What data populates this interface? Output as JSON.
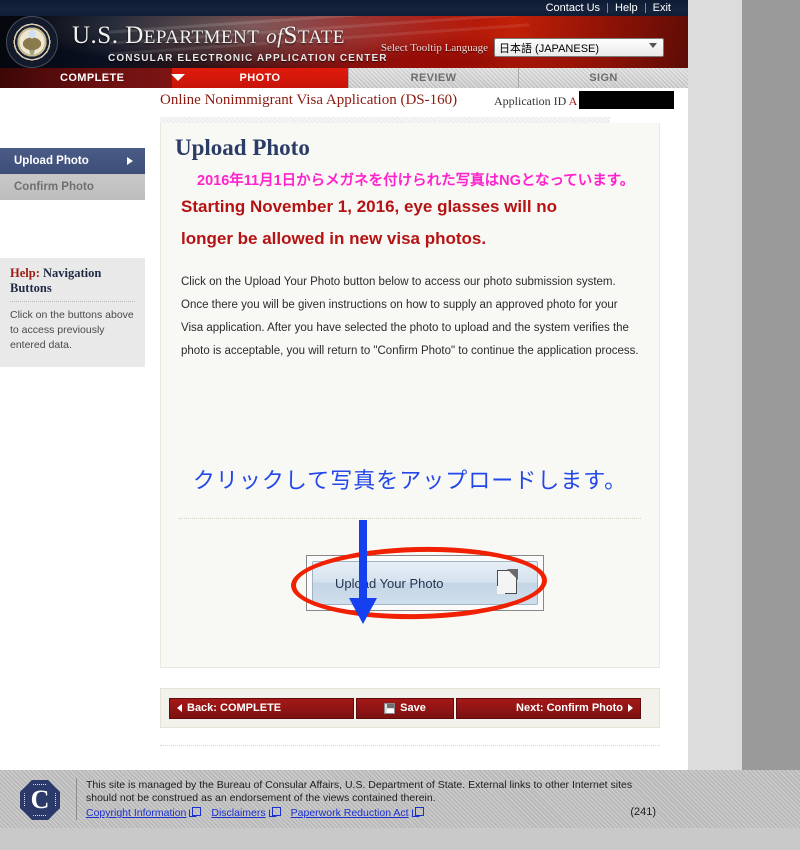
{
  "topbar": {
    "links": [
      "Contact Us",
      "Help",
      "Exit"
    ]
  },
  "banner": {
    "brand_line1_a": "U.S. D",
    "brand_line1_b": "EPARTMENT",
    "brand_line1_c": "of",
    "brand_line1_d": "S",
    "brand_line1_e": "TATE",
    "brand_sub": "CONSULAR ELECTRONIC APPLICATION CENTER",
    "language_label": "Select Tooltip Language",
    "language_value": "日本語 (JAPANESE)",
    "seal_name": "us-department-of-state-seal"
  },
  "tabs": [
    {
      "label": "COMPLETE",
      "state": "done"
    },
    {
      "label": "PHOTO",
      "state": "active"
    },
    {
      "label": "REVIEW",
      "state": "idle"
    },
    {
      "label": "SIGN",
      "state": "idle"
    }
  ],
  "header": {
    "app_title": "Online Nonimmigrant Visa Application (DS-160)",
    "application_id_label": "Application ID ",
    "application_id_prefix": "A",
    "application_id_value": ""
  },
  "sidebar": {
    "items": [
      {
        "label": "Upload Photo",
        "state": "current"
      },
      {
        "label": "Confirm Photo",
        "state": "muted"
      }
    ],
    "help": {
      "title_highlight": "Help:",
      "title_rest": " Navigation Buttons",
      "text": "Click on the buttons above to access previously entered data."
    }
  },
  "main": {
    "page_title": "Upload Photo",
    "warning_jp": "2016年11月1日からメガネを付けられた写真はNGとなっています。",
    "warning_en_line1": "Starting November 1, 2016, eye glasses will no",
    "warning_en_line2": "longer be allowed in new visa photos.",
    "body_paragraph": "Click on the Upload Your Photo button below to access our photo submission system. Once there you will be given instructions on how to supply an approved photo for your Visa application. After you have selected the photo to upload and the system verifies the photo is acceptable, you will return to \"Confirm Photo\" to continue the application process.",
    "annotation_jp": "クリックして写真をアップロードします。",
    "upload_button_label": "Upload Your Photo"
  },
  "footer_nav": {
    "back_label": "Back: COMPLETE",
    "save_label": "Save",
    "next_label": "Next: Confirm Photo"
  },
  "footer": {
    "text": "This site is managed by the Bureau of Consular Affairs, U.S. Department of State. External links to other Internet sites should not be construed as an endorsement of the views contained therein.",
    "links": [
      "Copyright Information",
      "Disclaimers",
      "Paperwork Reduction Act"
    ],
    "page_count": "(241)",
    "seal_letter": "C"
  },
  "colors": {
    "banner_red": "#a81208",
    "tab_active": "#c8140a",
    "nav_current": "#3d4f78",
    "warning_jp": "#ff22cc",
    "warning_en": "#b51313",
    "annotation_blue": "#2347e8",
    "ellipse_red": "#f02000",
    "link_blue": "#1a2fcf",
    "title_blue": "#2c3c66",
    "app_title_red": "#8b1a10"
  }
}
